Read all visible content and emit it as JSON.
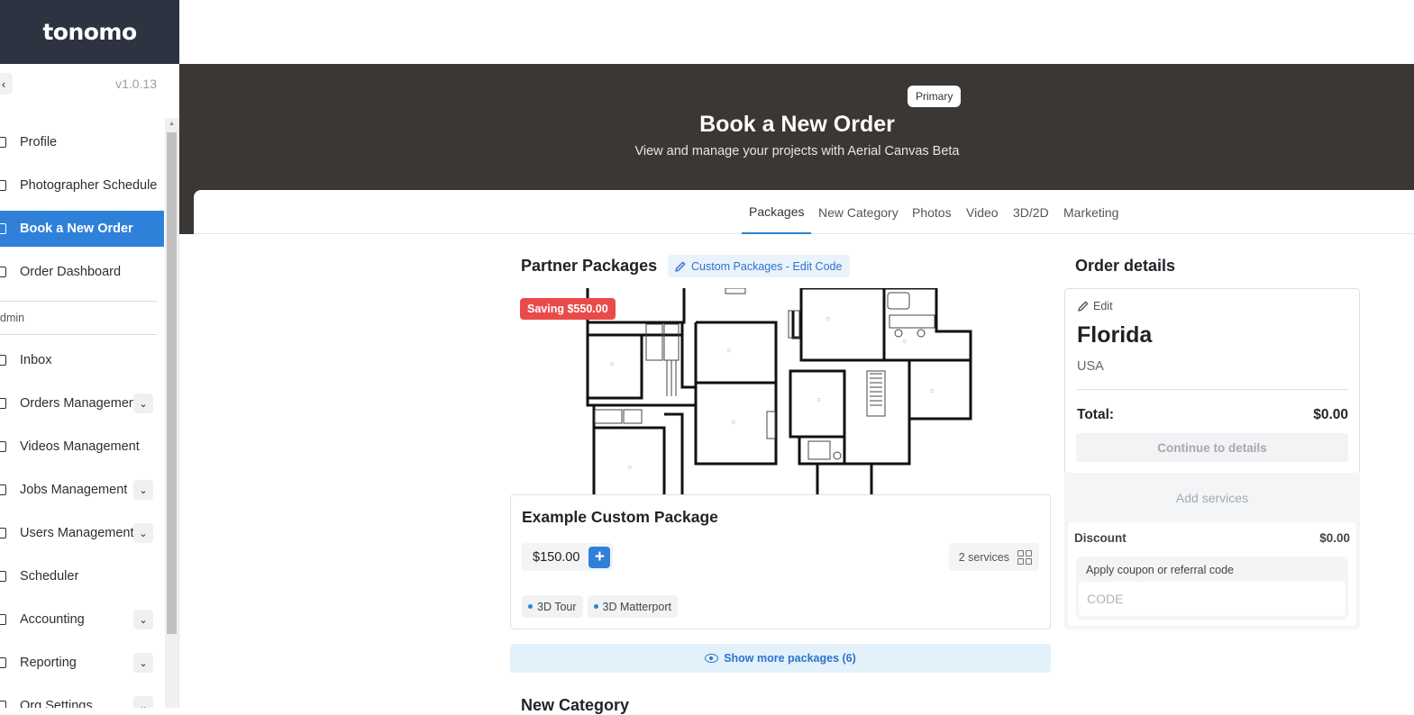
{
  "app": {
    "logo": "tonomo",
    "version": "v1.0.13"
  },
  "sidebar": {
    "items": [
      {
        "label": "Profile",
        "icon": "person-icon",
        "active": false,
        "expandable": false
      },
      {
        "label": "Photographer Schedule",
        "icon": "document-icon",
        "active": false,
        "expandable": false
      },
      {
        "label": "Book a New Order",
        "icon": "document-icon",
        "active": true,
        "expandable": false
      },
      {
        "label": "Order Dashboard",
        "icon": "home-icon",
        "active": false,
        "expandable": false
      }
    ],
    "section_label": "dmin",
    "admin_items": [
      {
        "label": "Inbox",
        "icon": "mail-icon",
        "expandable": false
      },
      {
        "label": "Orders Management",
        "icon": "orders-icon",
        "expandable": true
      },
      {
        "label": "Videos Management",
        "icon": "video-icon",
        "expandable": false
      },
      {
        "label": "Jobs Management",
        "icon": "jobs-icon",
        "expandable": true
      },
      {
        "label": "Users Management",
        "icon": "users-icon",
        "expandable": true
      },
      {
        "label": "Scheduler",
        "icon": "calendar-icon",
        "expandable": false
      },
      {
        "label": "Accounting",
        "icon": "accounting-icon",
        "expandable": true
      },
      {
        "label": "Reporting",
        "icon": "report-icon",
        "expandable": true
      },
      {
        "label": "Org Settings",
        "icon": "settings-icon",
        "expandable": true
      }
    ]
  },
  "hero": {
    "badge": "Primary",
    "title": "Book a New Order",
    "subtitle": "View and manage your projects with Aerial Canvas Beta"
  },
  "tabs": [
    {
      "label": "Packages",
      "active": true
    },
    {
      "label": "New Category",
      "active": false
    },
    {
      "label": "Photos",
      "active": false
    },
    {
      "label": "Video",
      "active": false
    },
    {
      "label": "3D/2D",
      "active": false
    },
    {
      "label": "Marketing",
      "active": false
    }
  ],
  "packages": {
    "section_title": "Partner Packages",
    "edit_code_label": "Custom Packages - Edit Code",
    "saving_badge": "Saving $550.00",
    "card": {
      "name": "Example Custom Package",
      "price": "$150.00",
      "services_count": "2 services",
      "tags": [
        "3D Tour",
        "3D Matterport"
      ]
    },
    "show_more": "Show more packages (6)",
    "next_section_title": "New Category"
  },
  "order_details": {
    "title": "Order details",
    "edit_label": "Edit",
    "city": "Florida",
    "country": "USA",
    "total_label": "Total:",
    "total_value": "$0.00",
    "continue_label": "Continue to details",
    "add_services": "Add services",
    "discount_label": "Discount",
    "discount_value": "$0.00",
    "coupon_label": "Apply coupon or referral code",
    "coupon_placeholder": "CODE"
  },
  "colors": {
    "accent": "#2f80d9",
    "sidebar_header": "#2d3340",
    "hero_bg": "#3b3735",
    "saving_badge": "#e94b4b"
  }
}
